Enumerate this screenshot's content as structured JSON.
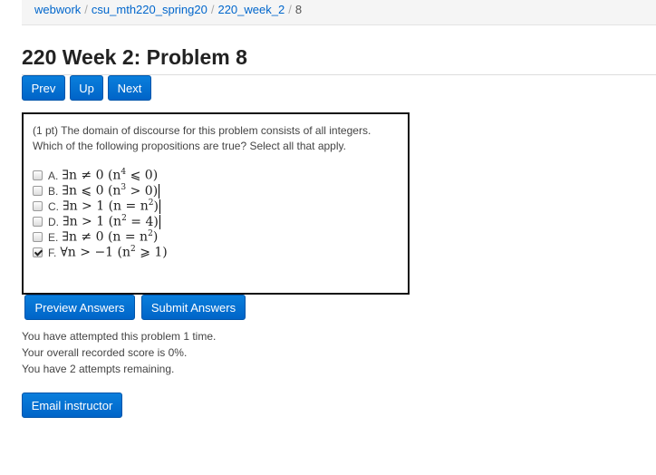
{
  "breadcrumb": {
    "items": [
      "webwork",
      "csu_mth220_spring20",
      "220_week_2"
    ],
    "current": "8",
    "separator": "/"
  },
  "page_title": "220 Week 2: Problem 8",
  "nav": {
    "prev": "Prev",
    "up": "Up",
    "next": "Next"
  },
  "problem": {
    "line1": "(1 pt) The domain of discourse for this problem consists of all integers.",
    "line2": "Which of the following propositions are true? Select all that apply.",
    "options": [
      {
        "letter": "A.",
        "pre": "∃n ≠ 0 (n",
        "exp": "4",
        "post": " ⩽ 0)",
        "checked": false
      },
      {
        "letter": "B.",
        "pre": "∃n ⩽ 0 (n",
        "exp": "3",
        "post": " > 0)",
        "checked": false
      },
      {
        "letter": "C.",
        "pre": "∃n > 1 (n = n",
        "exp": "2",
        "post": ")",
        "checked": false
      },
      {
        "letter": "D.",
        "pre": "∃n > 1 (n",
        "exp": "2",
        "post": " = 4)",
        "checked": false
      },
      {
        "letter": "E.",
        "pre": "∃n ≠ 0 (n = n",
        "exp": "2",
        "post": ")",
        "checked": false
      },
      {
        "letter": "F.",
        "pre": "∀n > −1 (n",
        "exp": "2",
        "post": " ⩾ 1)",
        "checked": true
      }
    ]
  },
  "actions": {
    "preview": "Preview Answers",
    "submit": "Submit Answers"
  },
  "status": {
    "attempted": "You have attempted this problem 1 time.",
    "score": "Your overall recorded score is 0%.",
    "remaining": "You have 2 attempts remaining."
  },
  "email_button": "Email instructor",
  "colors": {
    "primary_button": "#0072d6",
    "link": "#0066cc",
    "border": "#111111"
  }
}
